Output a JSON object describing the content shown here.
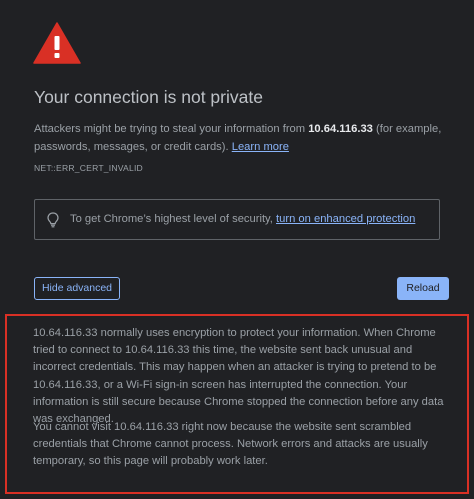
{
  "colors": {
    "background": "#202124",
    "warning_red": "#d93025",
    "link_blue": "#8ab4f8",
    "title_text": "#bdc1c6",
    "body_text": "#9aa0a6",
    "highlight_frame": "#d93025"
  },
  "icons": {
    "warning": "warning-triangle-icon",
    "bulb": "lightbulb-icon"
  },
  "page": {
    "title": "Your connection is not private",
    "description_prefix": "Attackers might be trying to steal your information from ",
    "host": "10.64.116.33",
    "description_suffix": " (for example, passwords, messages, or credit cards). ",
    "learn_more": "Learn more",
    "error_code": "NET::ERR_CERT_INVALID"
  },
  "security_box": {
    "text": "To get Chrome’s highest level of security, ",
    "link": "turn on enhanced protection"
  },
  "buttons": {
    "hide_advanced": "Hide advanced",
    "reload": "Reload"
  },
  "details": {
    "paragraph1": "10.64.116.33 normally uses encryption to protect your information. When Chrome tried to connect to 10.64.116.33 this time, the website sent back unusual and incorrect credentials. This may happen when an attacker is trying to pretend to be 10.64.116.33, or a Wi-Fi sign-in screen has interrupted the connection. Your information is still secure because Chrome stopped the connection before any data was exchanged.",
    "paragraph2": "You cannot visit 10.64.116.33 right now because the website sent scrambled credentials that Chrome cannot process. Network errors and attacks are usually temporary, so this page will probably work later."
  }
}
